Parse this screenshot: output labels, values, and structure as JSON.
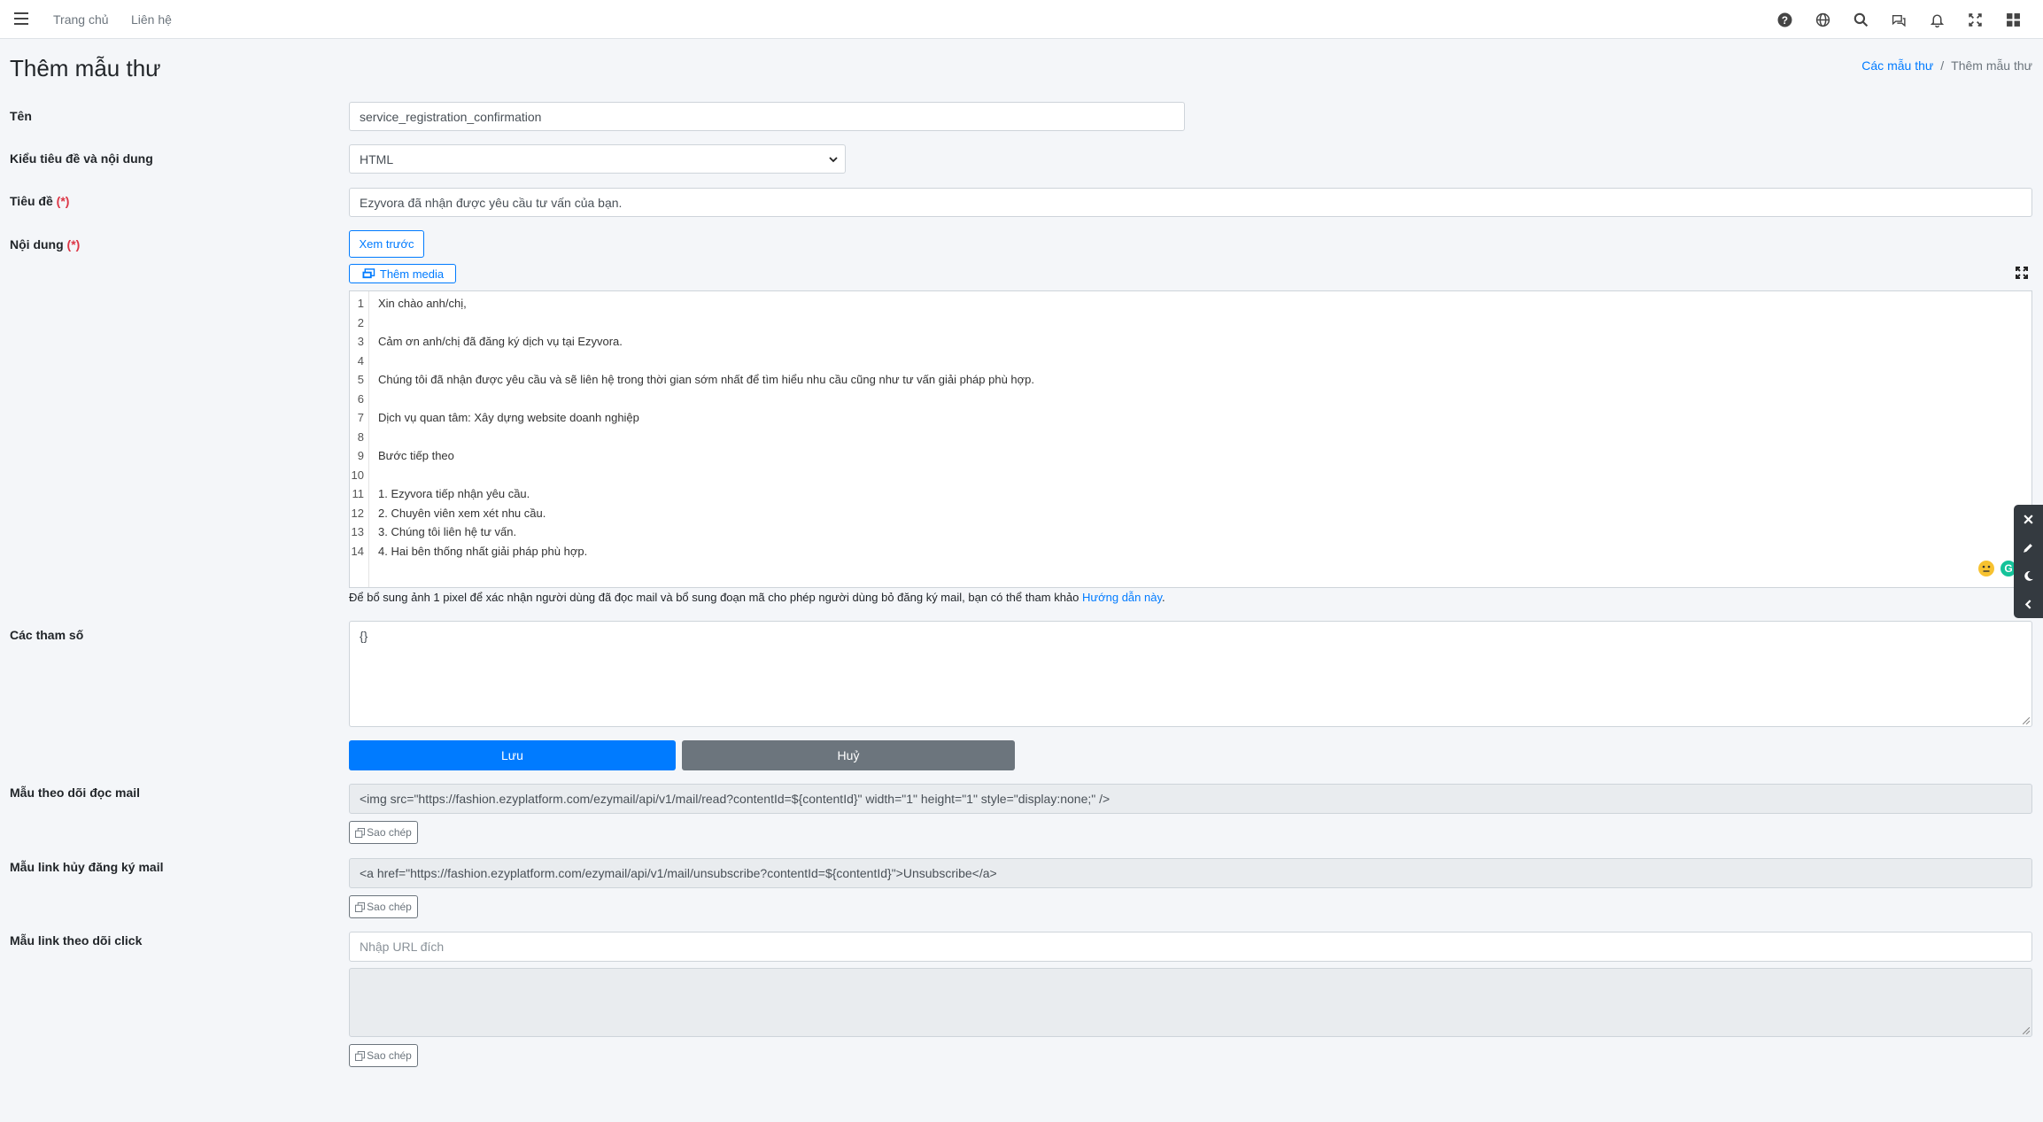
{
  "navbar": {
    "home": "Trang chủ",
    "contact": "Liên hệ",
    "icons": [
      "help-icon",
      "globe-icon",
      "search-icon",
      "chat-icon",
      "bell-icon",
      "fullscreen-icon",
      "apps-grid-icon"
    ]
  },
  "header": {
    "title": "Thêm mẫu thư",
    "breadcrumb": {
      "parent": "Các mẫu thư",
      "separator": "/",
      "current": "Thêm mẫu thư"
    }
  },
  "form": {
    "name_label": "Tên",
    "name_value": "service_registration_confirmation",
    "type_label": "Kiểu tiêu đề và nội dung",
    "type_value": "HTML",
    "subject_label": "Tiêu đề",
    "subject_value": "Ezyvora đã nhận được yêu cầu tư vấn của bạn.",
    "content_label": "Nội dung",
    "required_mark": "(*)",
    "preview_button": "Xem trước",
    "add_media_button": "Thêm media",
    "editor_lines": [
      "Xin chào anh/chị,",
      "",
      "Cảm ơn anh/chị đã đăng ký dịch vụ tại Ezyvora.",
      "",
      "Chúng tôi đã nhận được yêu cầu và sẽ liên hệ trong thời gian sớm nhất để tìm hiểu nhu cầu cũng như tư vấn giải pháp phù hợp.",
      "",
      "Dịch vụ quan tâm: Xây dựng website doanh nghiệp",
      "",
      "Bước tiếp theo",
      "",
      "1. Ezyvora tiếp nhận yêu cầu.",
      "2. Chuyên viên xem xét nhu cầu.",
      "3. Chúng tôi liên hệ tư vấn.",
      "4. Hai bên thống nhất giải pháp phù hợp."
    ],
    "line_numbers": [
      "1",
      "2",
      "3",
      "4",
      "5",
      "6",
      "7",
      "8",
      "9",
      "10",
      "11",
      "12",
      "13",
      "14"
    ],
    "hint_text": "Để bổ sung ảnh 1 pixel để xác nhận người dùng đã đọc mail và bổ sung đoạn mã cho phép người dùng bỏ đăng ký mail, bạn có thể tham khảo ",
    "hint_link": "Hướng dẫn này",
    "hint_end": ".",
    "params_label": "Các tham số",
    "params_value": "{}",
    "save_button": "Lưu",
    "cancel_button": "Huỷ",
    "read_tracking_label": "Mẫu theo dõi đọc mail",
    "read_tracking_value": "<img src=\"https://fashion.ezyplatform.com/ezymail/api/v1/mail/read?contentId=${contentId}\" width=\"1\" height=\"1\" style=\"display:none;\" />",
    "unsubscribe_label": "Mẫu link hủy đăng ký mail",
    "unsubscribe_value": "<a href=\"https://fashion.ezyplatform.com/ezymail/api/v1/mail/unsubscribe?contentId=${contentId}\">Unsubscribe</a>",
    "click_tracking_label": "Mẫu link theo dõi click",
    "click_tracking_placeholder": "Nhập URL đích",
    "copy_button": "Sao chép"
  },
  "side_tools": [
    "close-icon",
    "pencil-icon",
    "moon-icon",
    "chevron-left-icon"
  ],
  "colors": {
    "primary": "#007bff",
    "secondary": "#6c757d",
    "required": "#dc3545",
    "grammarly": "#15c39a"
  }
}
